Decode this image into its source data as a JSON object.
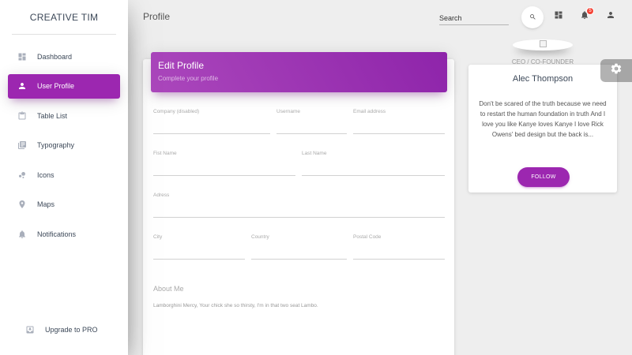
{
  "brand": "CREATIVE TIM",
  "sidebar": {
    "items": [
      {
        "label": "Dashboard",
        "icon": "dashboard-icon"
      },
      {
        "label": "User Profile",
        "icon": "person-icon",
        "active": true
      },
      {
        "label": "Table List",
        "icon": "clipboard-icon"
      },
      {
        "label": "Typography",
        "icon": "library-books-icon"
      },
      {
        "label": "Icons",
        "icon": "bubble-chart-icon"
      },
      {
        "label": "Maps",
        "icon": "location-icon"
      },
      {
        "label": "Notifications",
        "icon": "bell-icon"
      }
    ],
    "upgrade": {
      "label": "Upgrade to PRO",
      "icon": "unarchive-icon"
    }
  },
  "topbar": {
    "title": "Profile",
    "search_placeholder": "Search",
    "notification_count": "5"
  },
  "edit_profile": {
    "title": "Edit Profile",
    "subtitle": "Complete your profile",
    "fields": {
      "company": "Company (disabled)",
      "username": "Username",
      "email": "Email address",
      "first_name": "Fist Name",
      "last_name": "Last Name",
      "address": "Adress",
      "city": "City",
      "country": "Country",
      "postal": "Postal Code"
    },
    "about_label": "About Me",
    "about_text": "Lamborghini Mercy, Your chick she so thirsty, I'm in that two seat Lambo."
  },
  "profile": {
    "role": "CEO / CO-FOUNDER",
    "name": "Alec Thompson",
    "description": "Don't be scared of the truth because we need to restart the human foundation in truth And I love you like Kanye loves Kanye I love Rick Owens' bed design but the back is...",
    "follow_label": "FOLLOW"
  },
  "colors": {
    "accent": "#9c27b0",
    "badge": "#f44336"
  }
}
